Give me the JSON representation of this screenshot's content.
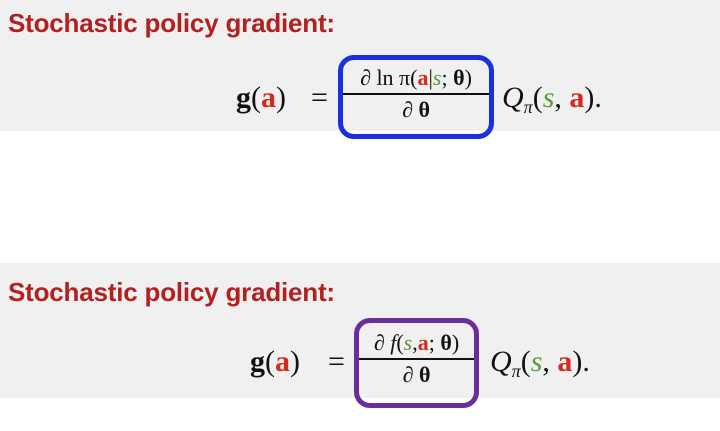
{
  "section_1": {
    "heading": "Stochastic policy gradient:",
    "lhs_func": "g",
    "lhs_open": "(",
    "lhs_arg": "a",
    "lhs_close": ")",
    "equals": "=",
    "num_prefix": "∂ ln π(",
    "num_a": "a",
    "num_bar": "|",
    "num_s": "s",
    "num_semi": "; ",
    "num_theta": "θ",
    "num_close": ")",
    "den_partial": "∂ ",
    "den_theta": "θ",
    "q_symbol": "Q",
    "q_sub": "π",
    "q_open": "(",
    "q_s": "s",
    "q_comma": ", ",
    "q_a": "a",
    "q_close": ").",
    "box_color": "#1a2fe0"
  },
  "section_2": {
    "heading": "Stochastic policy gradient:",
    "lhs_func": "g",
    "lhs_open": "(",
    "lhs_arg": "a",
    "lhs_close": ")",
    "equals": "=",
    "num_prefix": "∂ ",
    "num_f": "f",
    "num_open": "(",
    "num_s": "s",
    "num_comma": ",",
    "num_a": "a",
    "num_semi": "; ",
    "num_theta": "θ",
    "num_close": ")",
    "den_partial": "∂ ",
    "den_theta": "θ",
    "q_symbol": "Q",
    "q_sub": "π",
    "q_open": "(",
    "q_s": "s",
    "q_comma": ", ",
    "q_a": "a",
    "q_close": ").",
    "box_color": "#6a2e9a"
  }
}
